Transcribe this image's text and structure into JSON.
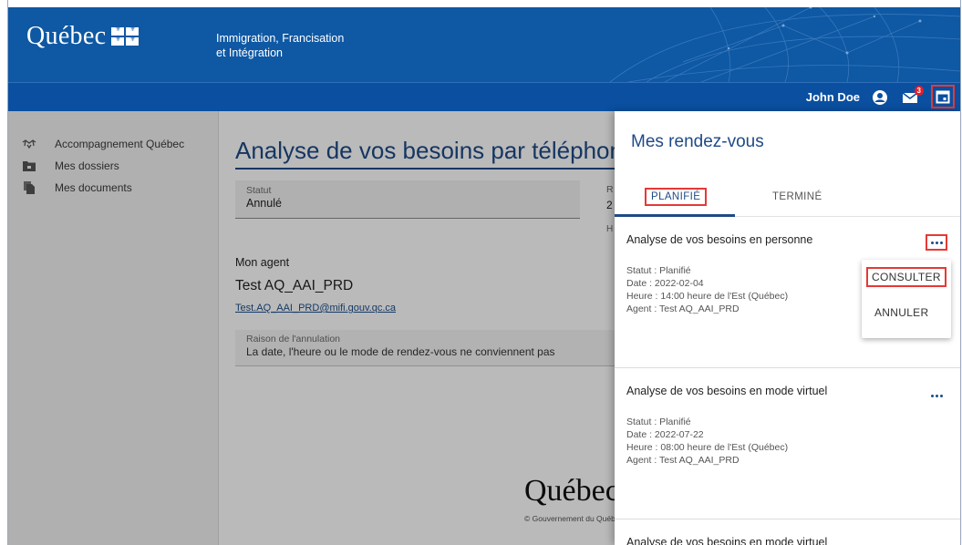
{
  "header": {
    "logo_text": "Québec",
    "ministry_line1": "Immigration, Francisation",
    "ministry_line2": "et Intégration"
  },
  "topbar": {
    "user_name": "John Doe",
    "mail_count": "3"
  },
  "sidebar": {
    "items": [
      {
        "label": "Accompagnement Québec",
        "icon": "handshake-icon"
      },
      {
        "label": "Mes dossiers",
        "icon": "folder-icon"
      },
      {
        "label": "Mes documents",
        "icon": "documents-icon"
      }
    ]
  },
  "main": {
    "title": "Analyse de vos besoins par téléphone",
    "status_label": "Statut",
    "status_value": "Annulé",
    "partial_r": "R",
    "partial_2": "2",
    "partial_h": "H",
    "agent_heading": "Mon agent",
    "agent_name": "Test AQ_AAI_PRD",
    "agent_email": "Test.AQ_AAI_PRD@mifi.gouv.qc.ca",
    "reason_label": "Raison de l'annulation",
    "reason_value": "La date, l'heure ou le mode de rendez-vous ne conviennent pas",
    "footer_logo": "Québec",
    "footer_copy": "© Gouvernement du Québec"
  },
  "panel": {
    "title": "Mes rendez-vous",
    "tabs": [
      {
        "label": "PLANIFIÉ",
        "active": true
      },
      {
        "label": "TERMINÉ",
        "active": false
      }
    ],
    "appointments": [
      {
        "title": "Analyse de vos besoins en personne",
        "status": "Statut : Planifié",
        "date": "Date : 2022-02-04",
        "time": "Heure : 14:00 heure de l'Est (Québec)",
        "agent": "Agent : Test AQ_AAI_PRD"
      },
      {
        "title": "Analyse de vos besoins en mode virtuel",
        "status": "Statut : Planifié",
        "date": "Date : 2022-07-22",
        "time": "Heure : 08:00 heure de l'Est (Québec)",
        "agent": "Agent : Test AQ_AAI_PRD"
      },
      {
        "title": "Analyse de vos besoins en mode virtuel"
      }
    ],
    "menu": {
      "consult": "CONSULTER",
      "cancel": "ANNULER"
    }
  },
  "colors": {
    "header_blue": "#0e58a4",
    "bar_blue": "#0a4fa0",
    "title_blue": "#1e4a86",
    "highlight_red": "#e53935",
    "badge_red": "#e21d2a"
  }
}
